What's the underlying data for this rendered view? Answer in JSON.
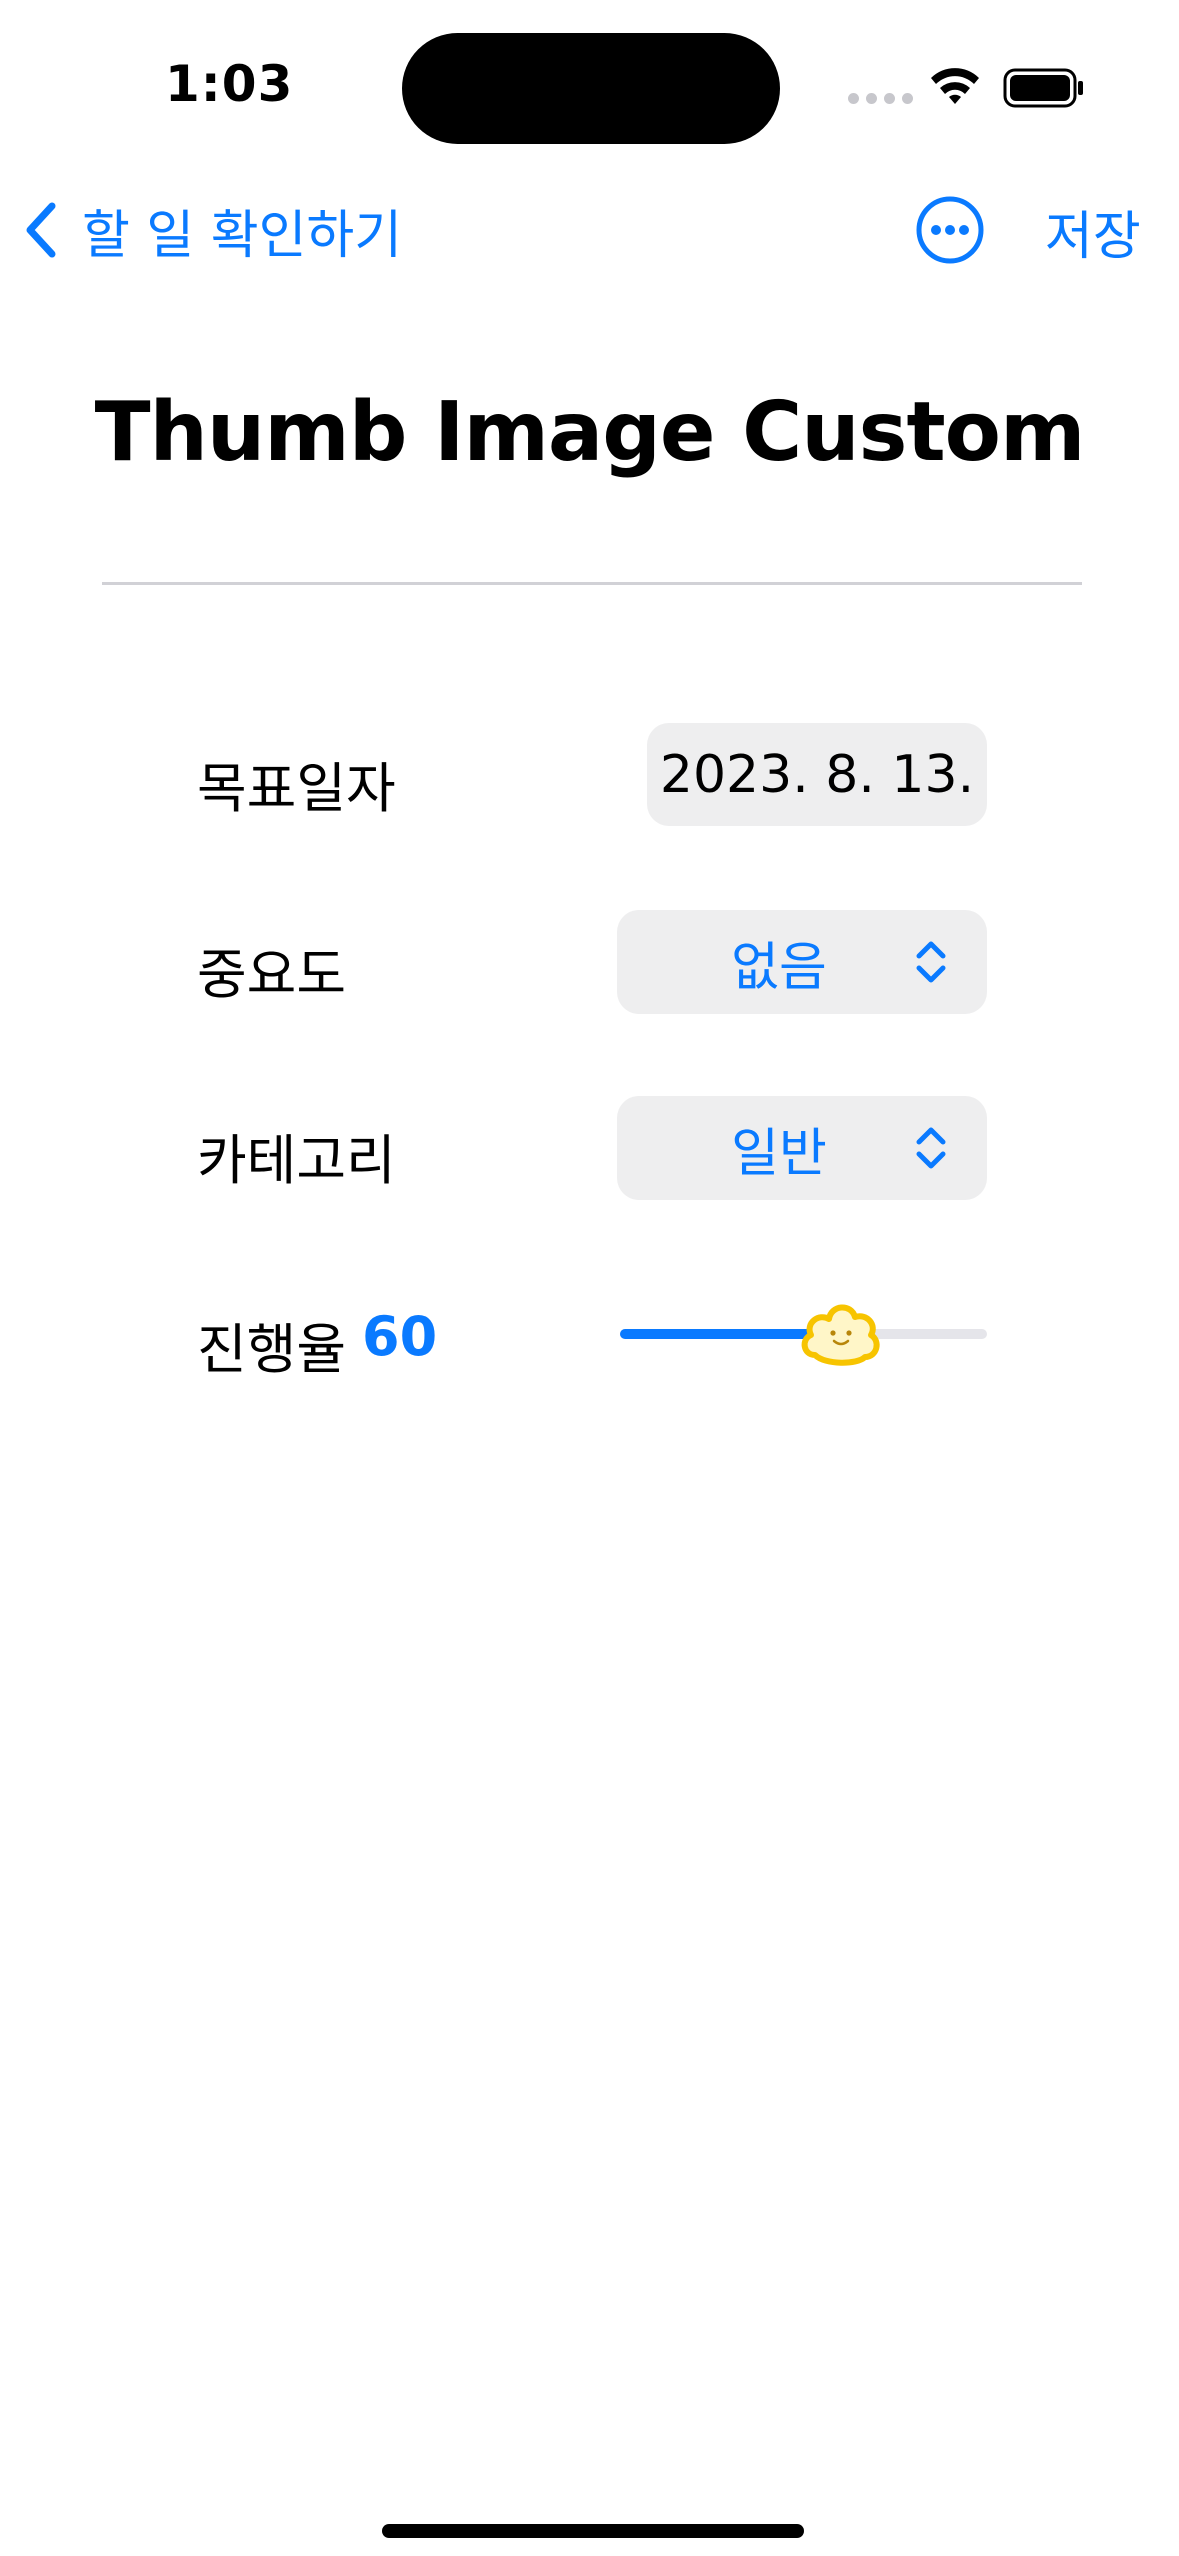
{
  "status_bar": {
    "time": "1:03",
    "icons": [
      "signal-dots-icon",
      "wifi-icon",
      "battery-icon"
    ]
  },
  "nav": {
    "back_label": "할 일 확인하기",
    "more_icon": "ellipsis-circle-icon",
    "save_label": "저장"
  },
  "title": "Thumb Image Custom",
  "form": {
    "target_date": {
      "label": "목표일자",
      "value": "2023. 8. 13."
    },
    "importance": {
      "label": "중요도",
      "value": "없음",
      "icon": "chevron-up-down-icon"
    },
    "category": {
      "label": "카테고리",
      "value": "일반",
      "icon": "chevron-up-down-icon"
    },
    "progress": {
      "label": "진행율",
      "value": "60",
      "fraction": 0.6,
      "thumb_icon": "smiley-cloud-icon"
    }
  },
  "colors": {
    "accent": "#0a7aff",
    "pill_bg": "#eeeeef",
    "thumb": "#f7c400",
    "track": "#e5e5ea"
  }
}
